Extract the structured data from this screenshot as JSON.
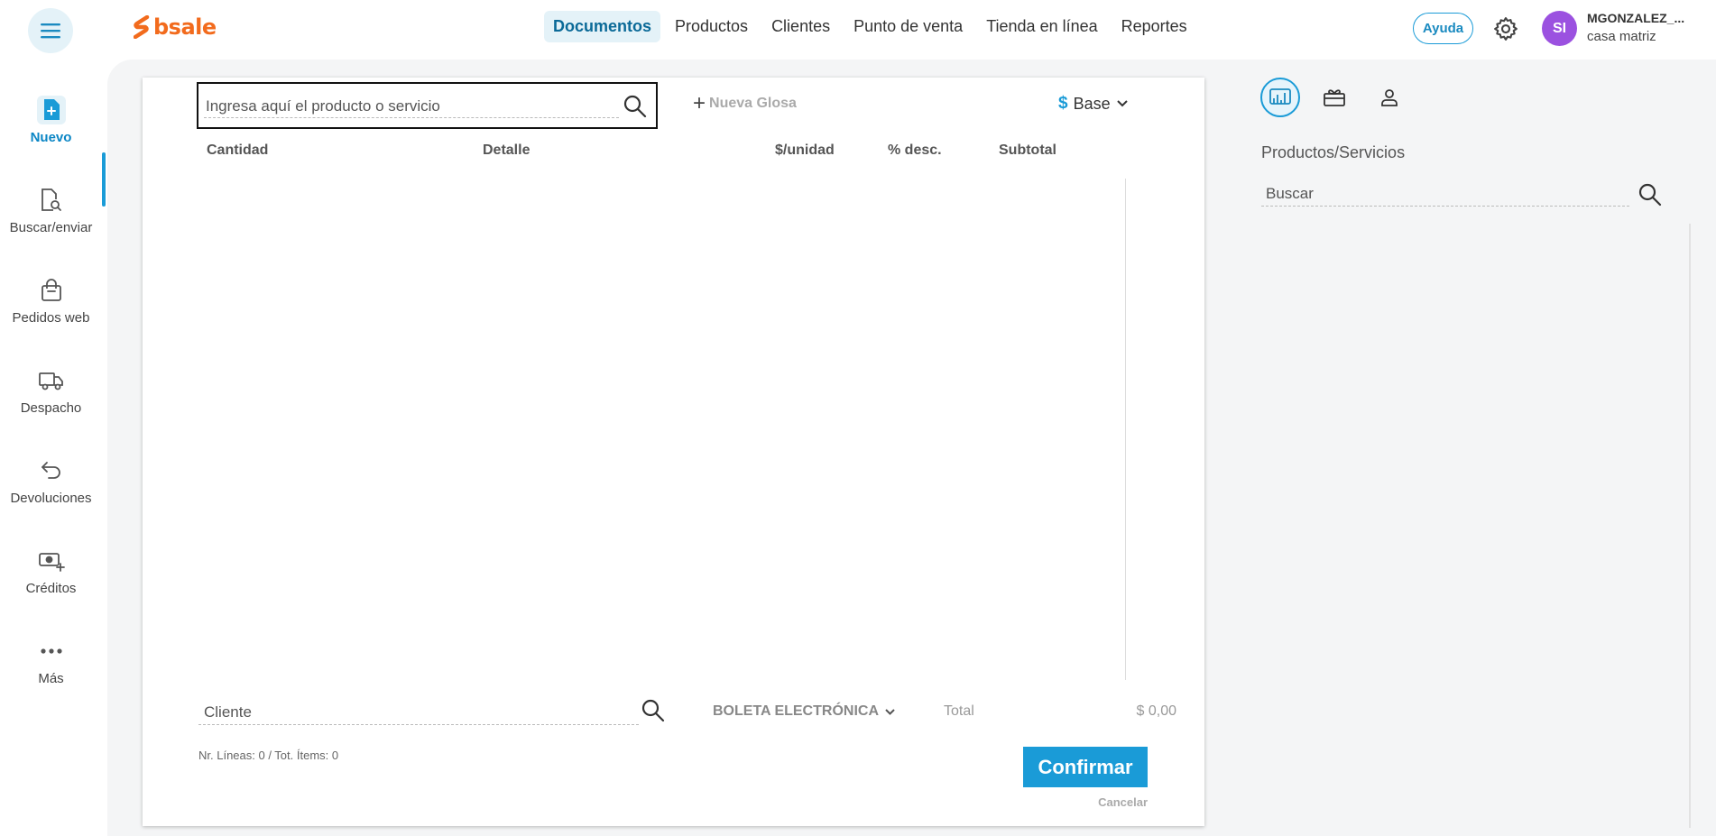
{
  "brand": {
    "logo_text": "bsale",
    "logo_color": "#f26b1d"
  },
  "topnav": {
    "items": [
      {
        "label": "Documentos",
        "active": true
      },
      {
        "label": "Productos"
      },
      {
        "label": "Clientes"
      },
      {
        "label": "Punto de venta"
      },
      {
        "label": "Tienda en línea"
      },
      {
        "label": "Reportes"
      }
    ],
    "help_label": "Ayuda",
    "user": {
      "initials": "SI",
      "name": "MGONZALEZ_...",
      "branch": "casa matriz"
    }
  },
  "sidebar": {
    "items": [
      {
        "label": "Nuevo",
        "icon": "new-document-icon",
        "active": true
      },
      {
        "label": "Buscar/enviar",
        "icon": "search-document-icon"
      },
      {
        "label": "Pedidos web",
        "icon": "shopping-bag-icon"
      },
      {
        "label": "Despacho",
        "icon": "truck-icon"
      },
      {
        "label": "Devoluciones",
        "icon": "return-arrow-icon"
      },
      {
        "label": "Créditos",
        "icon": "cash-plus-icon"
      },
      {
        "label": "Más",
        "icon": "more-dots-icon"
      }
    ]
  },
  "document": {
    "product_search_placeholder": "Ingresa aquí el producto o servicio",
    "new_gloss_label": "Nueva Glosa",
    "price_list": {
      "symbol": "$",
      "label": "Base"
    },
    "columns": [
      "Cantidad",
      "Detalle",
      "$/unidad",
      "% desc.",
      "Subtotal"
    ],
    "client_placeholder": "Cliente",
    "doc_type": "BOLETA ELECTRÓNICA",
    "total_label": "Total",
    "total_value": "$ 0,00",
    "counts": "Nr. Líneas: 0 / Tot. Ítems: 0",
    "confirm_label": "Confirmar",
    "cancel_label": "Cancelar"
  },
  "right_panel": {
    "tabs": [
      "products-tab-icon",
      "gift-card-icon",
      "person-icon"
    ],
    "title": "Productos/Servicios",
    "search_placeholder": "Buscar"
  },
  "colors": {
    "accent": "#1a9bd7",
    "active_bg": "#e4f2f8",
    "avatar": "#9b51e0"
  }
}
